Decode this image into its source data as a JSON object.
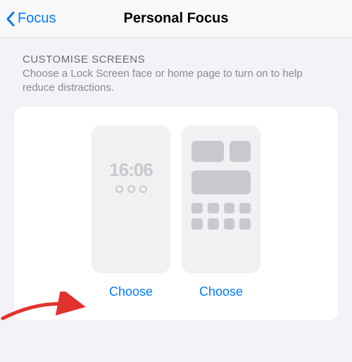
{
  "nav": {
    "back_label": "Focus",
    "title": "Personal Focus"
  },
  "section": {
    "heading": "CUSTOMISE SCREENS",
    "description": "Choose a Lock Screen face or home page to turn on to help reduce distractions."
  },
  "lock_preview": {
    "time": "16:06"
  },
  "buttons": {
    "choose_lock": "Choose",
    "choose_home": "Choose"
  }
}
